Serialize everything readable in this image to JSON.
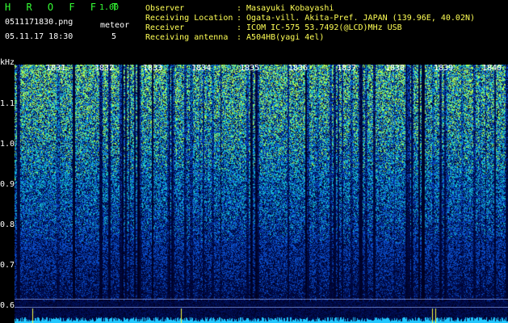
{
  "app": {
    "title": "H R O F F T",
    "version": "1.00",
    "filename": "0511171830.png",
    "datetime": "05.11.17 18:30",
    "meteor_label": "meteor",
    "meteor_count": "5"
  },
  "info": {
    "observer_label": "Observer",
    "observer_value": ": Masayuki Kobayashi",
    "location_label": "Receiving Location",
    "location_value": ": Ogata-vill. Akita-Pref. JAPAN (139.96E, 40.02N)",
    "receiver_label": "Receiver",
    "receiver_value": ": ICOM IC-575 53.7492(@LCD)MHz USB",
    "antenna_label": "Receiving antenna",
    "antenna_value": ": A504HB(yagi 4el)"
  },
  "axis": {
    "y_unit": "kHz",
    "y_ticks": [
      "1.1",
      "1.0",
      "0.9",
      "0.8",
      "0.7",
      "0.6"
    ],
    "x_ticks": [
      "1831",
      "1832",
      "1833",
      "1834",
      "1835",
      "1836",
      "1837",
      "1838",
      "1839",
      "1840"
    ]
  },
  "colors": {
    "background": "#000000",
    "header_green": "#35ff35",
    "header_yellow": "#ffff55",
    "tick_white": "#ffffff"
  }
}
